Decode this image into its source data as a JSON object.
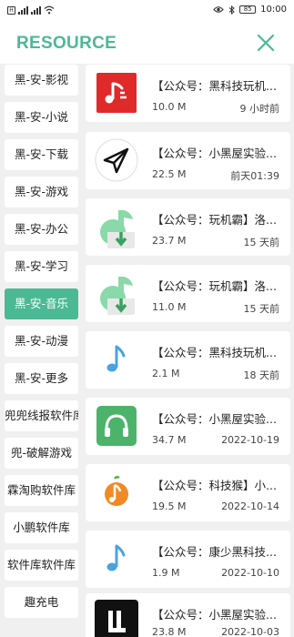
{
  "status": {
    "time": "10:00",
    "battery": "85"
  },
  "header": {
    "title": "RESOURCE",
    "accent": "#4cb995"
  },
  "sidebar": {
    "items": [
      {
        "label": "黑-安-影视"
      },
      {
        "label": "黑-安-小说"
      },
      {
        "label": "黑-安-下载"
      },
      {
        "label": "黑-安-游戏"
      },
      {
        "label": "黑-安-办公"
      },
      {
        "label": "黑-安-学习"
      },
      {
        "label": "黑-安-音乐",
        "active": true
      },
      {
        "label": "黑-安-动漫"
      },
      {
        "label": "黑-安-更多"
      },
      {
        "label": "兜兜线报软件库"
      },
      {
        "label": "兜-破解游戏"
      },
      {
        "label": "霖淘购软件库"
      },
      {
        "label": "小鹏软件库"
      },
      {
        "label": "软件库软件库"
      },
      {
        "label": "趣充电"
      }
    ]
  },
  "files": [
    {
      "title": "【公众号：黑科技玩机...",
      "size": "10.0 M",
      "date": "9 小时前",
      "icon": "music-note-red-icon"
    },
    {
      "title": "【公众号：小黑屋实验...",
      "size": "22.5 M",
      "date": "前天01:39",
      "icon": "paper-plane-icon"
    },
    {
      "title": "【公众号：玩机霸】洛...",
      "size": "23.7 M",
      "date": "15 天前",
      "icon": "green-note-download-icon"
    },
    {
      "title": "【公众号：玩机霸】洛...",
      "size": "11.0 M",
      "date": "15 天前",
      "icon": "green-note-download-icon"
    },
    {
      "title": "【公众号：黑科技玩机...",
      "size": "2.1 M",
      "date": "18 天前",
      "icon": "blue-music-note-icon"
    },
    {
      "title": "【公众号：小黑屋实验...",
      "size": "34.7 M",
      "date": "2022-10-19",
      "icon": "headphones-icon"
    },
    {
      "title": "【公众号：科技猴】小...",
      "size": "19.5 M",
      "date": "2022-10-14",
      "icon": "orange-music-icon"
    },
    {
      "title": "【公众号：康少黑科技...",
      "size": "1.9 M",
      "date": "2022-10-10",
      "icon": "blue-music-note-icon"
    },
    {
      "title": "【公众号：小黑屋实验...",
      "size": "23.8 M",
      "date": "2022-10-03",
      "icon": "black-logo-icon"
    }
  ]
}
